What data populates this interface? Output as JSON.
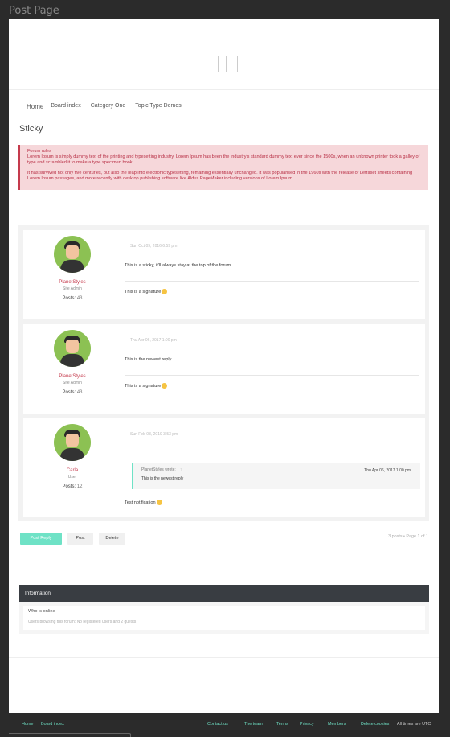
{
  "window_title": "Post Page",
  "nav": [
    "Home",
    "Board index",
    "Category One",
    "Topic Type Demos"
  ],
  "topic_title": "Sticky",
  "rules": {
    "heading": "Forum rules",
    "p1": "Lorem Ipsum is simply dummy text of the printing and typesetting industry. Lorem Ipsum has been the industry's standard dummy text ever since the 1500s, when an unknown printer took a galley of type and scrambled it to make a type specimen book.",
    "p2": "It has survived not only five centuries, but also the leap into electronic typesetting, remaining essentially unchanged. It was popularised in the 1960s with the release of Letraset sheets containing Lorem Ipsum passages, and more recently with desktop publishing software like Aldus PageMaker including versions of Lorem Ipsum."
  },
  "posts": [
    {
      "author": "PlanetStyles",
      "rank": "Site Admin",
      "posts_label": "Posts:",
      "posts_count": "43",
      "date": "Sun Oct 09, 2016 6:59 pm",
      "text": "This is a sticky, it'll always stay at the top of the forum.",
      "signature": "This is a signature"
    },
    {
      "author": "PlanetStyles",
      "rank": "Site Admin",
      "posts_label": "Posts:",
      "posts_count": "43",
      "date": "Thu Apr 06, 2017 1:00 pm",
      "text": "This is the newest reply",
      "signature": "This is a signature"
    },
    {
      "author": "Carla",
      "rank": "User",
      "posts_label": "Posts:",
      "posts_count": "12",
      "date": "Sun Feb 03, 2019 3:53 pm",
      "quote": {
        "author": "PlanetStyles",
        "wrote": "wrote:",
        "arrow": "↑",
        "date": "Thu Apr 06, 2017 1:00 pm",
        "text": "This is the newest reply"
      },
      "text": "Test notification"
    }
  ],
  "actions": {
    "reply": "Post Reply",
    "post": "Post",
    "delete": "Delete"
  },
  "pagination": "3 posts • Page 1 of 1",
  "information": {
    "heading": "Information",
    "who_online": "Who is online",
    "browsing": "Users browsing this forum: No registered users and 2 guests"
  },
  "footer": {
    "home": "Home",
    "board_index": "Board index",
    "contact": "Contact us",
    "team": "The team",
    "terms": "Terms",
    "privacy": "Privacy",
    "members": "Members",
    "delete_cookies": "Delete cookies",
    "times": "All times are UTC"
  },
  "colors": {
    "accent": "#6fe2c6",
    "author_red": "#c53a4c",
    "rules_bg": "#f6d7da",
    "info_header": "#393d42"
  }
}
